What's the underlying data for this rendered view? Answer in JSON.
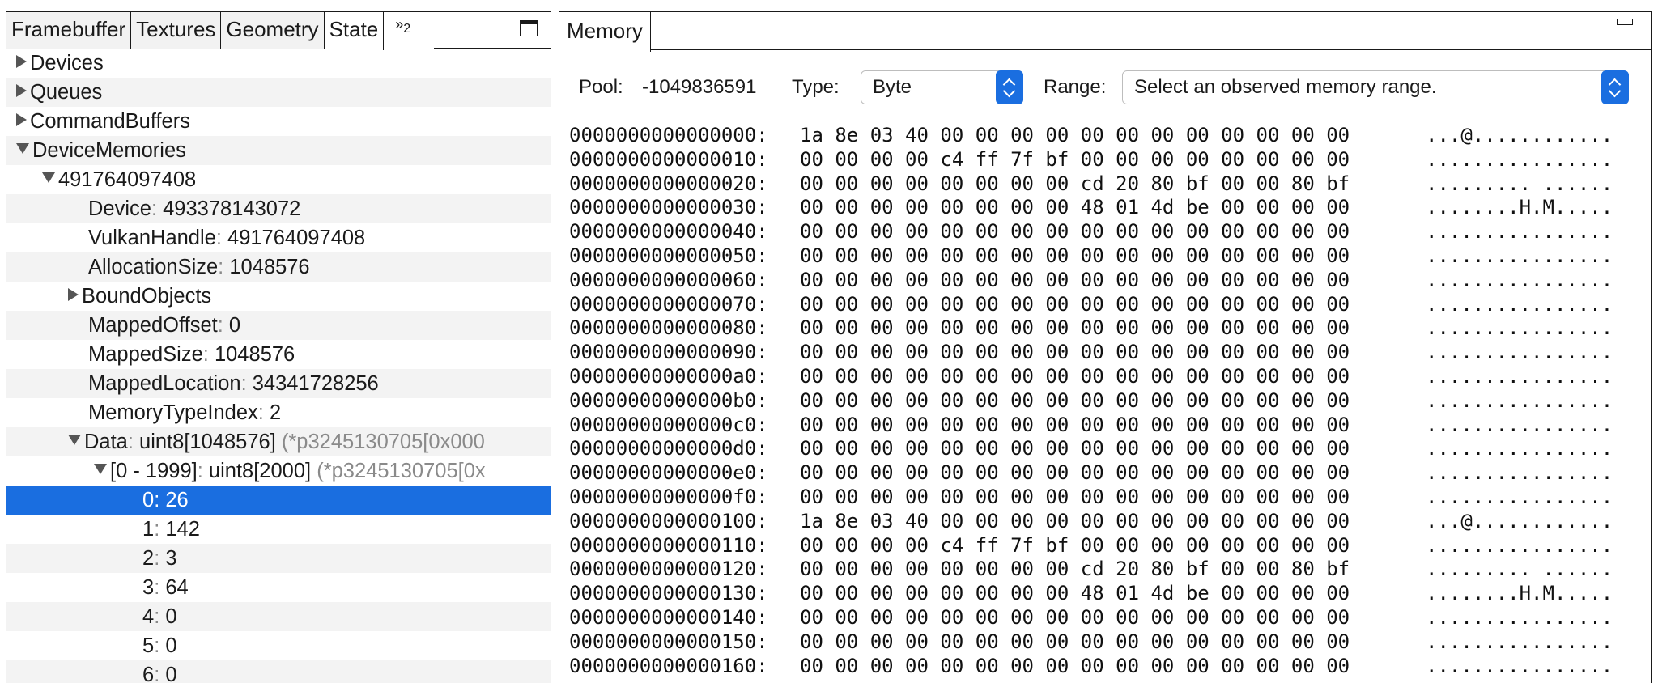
{
  "left_panel": {
    "tabs": [
      {
        "label": "Framebuffer",
        "name": "tab-framebuffer",
        "active": false
      },
      {
        "label": "Textures",
        "name": "tab-textures",
        "active": false
      },
      {
        "label": "Geometry",
        "name": "tab-geometry",
        "active": false
      },
      {
        "label": "State",
        "name": "tab-state",
        "active": true
      }
    ],
    "overflow_tab": {
      "icon": "»",
      "count": "2"
    },
    "tree": [
      {
        "indent": 0,
        "toggle": "right",
        "key": "Devices",
        "sep": "",
        "value": "",
        "extra": ""
      },
      {
        "indent": 0,
        "toggle": "right",
        "key": "Queues",
        "sep": "",
        "value": "",
        "extra": ""
      },
      {
        "indent": 0,
        "toggle": "right",
        "key": "CommandBuffers",
        "sep": "",
        "value": "",
        "extra": ""
      },
      {
        "indent": 0,
        "toggle": "down",
        "key": "DeviceMemories",
        "sep": "",
        "value": "",
        "extra": ""
      },
      {
        "indent": 1,
        "toggle": "down",
        "key": "491764097408",
        "sep": "",
        "value": "",
        "extra": ""
      },
      {
        "indent": 2,
        "toggle": "",
        "key": "Device",
        "sep": ": ",
        "value": "493378143072",
        "extra": ""
      },
      {
        "indent": 2,
        "toggle": "",
        "key": "VulkanHandle",
        "sep": ": ",
        "value": "491764097408",
        "extra": ""
      },
      {
        "indent": 2,
        "toggle": "",
        "key": "AllocationSize",
        "sep": ": ",
        "value": "1048576",
        "extra": ""
      },
      {
        "indent": 2,
        "toggle": "right",
        "key": "BoundObjects",
        "sep": "",
        "value": "",
        "extra": ""
      },
      {
        "indent": 2,
        "toggle": "",
        "key": "MappedOffset",
        "sep": ": ",
        "value": "0",
        "extra": ""
      },
      {
        "indent": 2,
        "toggle": "",
        "key": "MappedSize",
        "sep": ": ",
        "value": "1048576",
        "extra": ""
      },
      {
        "indent": 2,
        "toggle": "",
        "key": "MappedLocation",
        "sep": ": ",
        "value": "34341728256",
        "extra": ""
      },
      {
        "indent": 2,
        "toggle": "",
        "key": "MemoryTypeIndex",
        "sep": ": ",
        "value": "2",
        "extra": ""
      },
      {
        "indent": 2,
        "toggle": "down",
        "key": "Data",
        "sep": ": ",
        "value": "uint8[1048576]",
        "extra": " (*p3245130705[0x000"
      },
      {
        "indent": 3,
        "toggle": "down",
        "key": "[0 - 1999]",
        "sep": ": ",
        "value": "uint8[2000]",
        "extra": " (*p3245130705[0x"
      },
      {
        "indent": 4,
        "toggle": "",
        "key": "0",
        "sep": ": ",
        "value": "26",
        "extra": "",
        "selected": true
      },
      {
        "indent": 4,
        "toggle": "",
        "key": "1",
        "sep": ": ",
        "value": "142",
        "extra": ""
      },
      {
        "indent": 4,
        "toggle": "",
        "key": "2",
        "sep": ": ",
        "value": "3",
        "extra": ""
      },
      {
        "indent": 4,
        "toggle": "",
        "key": "3",
        "sep": ": ",
        "value": "64",
        "extra": ""
      },
      {
        "indent": 4,
        "toggle": "",
        "key": "4",
        "sep": ": ",
        "value": "0",
        "extra": ""
      },
      {
        "indent": 4,
        "toggle": "",
        "key": "5",
        "sep": ": ",
        "value": "0",
        "extra": ""
      },
      {
        "indent": 4,
        "toggle": "",
        "key": "6",
        "sep": ": ",
        "value": "0",
        "extra": ""
      }
    ]
  },
  "memory_panel": {
    "tab_label": "Memory",
    "pool_label": "Pool:",
    "pool_value": "-1049836591",
    "type_label": "Type:",
    "type_value": "Byte",
    "range_label": "Range:",
    "range_value": "Select an observed memory range.",
    "rows": [
      {
        "addr": "0000000000000000:",
        "bytes": "1a 8e 03 40 00 00 00 00 00 00 00 00 00 00 00 00",
        "ascii": "...@............"
      },
      {
        "addr": "0000000000000010:",
        "bytes": "00 00 00 00 c4 ff 7f bf 00 00 00 00 00 00 00 00",
        "ascii": "................"
      },
      {
        "addr": "0000000000000020:",
        "bytes": "00 00 00 00 00 00 00 00 cd 20 80 bf 00 00 80 bf",
        "ascii": "......... ......"
      },
      {
        "addr": "0000000000000030:",
        "bytes": "00 00 00 00 00 00 00 00 48 01 4d be 00 00 00 00",
        "ascii": "........H.M....."
      },
      {
        "addr": "0000000000000040:",
        "bytes": "00 00 00 00 00 00 00 00 00 00 00 00 00 00 00 00",
        "ascii": "................"
      },
      {
        "addr": "0000000000000050:",
        "bytes": "00 00 00 00 00 00 00 00 00 00 00 00 00 00 00 00",
        "ascii": "................"
      },
      {
        "addr": "0000000000000060:",
        "bytes": "00 00 00 00 00 00 00 00 00 00 00 00 00 00 00 00",
        "ascii": "................"
      },
      {
        "addr": "0000000000000070:",
        "bytes": "00 00 00 00 00 00 00 00 00 00 00 00 00 00 00 00",
        "ascii": "................"
      },
      {
        "addr": "0000000000000080:",
        "bytes": "00 00 00 00 00 00 00 00 00 00 00 00 00 00 00 00",
        "ascii": "................"
      },
      {
        "addr": "0000000000000090:",
        "bytes": "00 00 00 00 00 00 00 00 00 00 00 00 00 00 00 00",
        "ascii": "................"
      },
      {
        "addr": "00000000000000a0:",
        "bytes": "00 00 00 00 00 00 00 00 00 00 00 00 00 00 00 00",
        "ascii": "................"
      },
      {
        "addr": "00000000000000b0:",
        "bytes": "00 00 00 00 00 00 00 00 00 00 00 00 00 00 00 00",
        "ascii": "................"
      },
      {
        "addr": "00000000000000c0:",
        "bytes": "00 00 00 00 00 00 00 00 00 00 00 00 00 00 00 00",
        "ascii": "................"
      },
      {
        "addr": "00000000000000d0:",
        "bytes": "00 00 00 00 00 00 00 00 00 00 00 00 00 00 00 00",
        "ascii": "................"
      },
      {
        "addr": "00000000000000e0:",
        "bytes": "00 00 00 00 00 00 00 00 00 00 00 00 00 00 00 00",
        "ascii": "................"
      },
      {
        "addr": "00000000000000f0:",
        "bytes": "00 00 00 00 00 00 00 00 00 00 00 00 00 00 00 00",
        "ascii": "................"
      },
      {
        "addr": "0000000000000100:",
        "bytes": "1a 8e 03 40 00 00 00 00 00 00 00 00 00 00 00 00",
        "ascii": "...@............"
      },
      {
        "addr": "0000000000000110:",
        "bytes": "00 00 00 00 c4 ff 7f bf 00 00 00 00 00 00 00 00",
        "ascii": "................"
      },
      {
        "addr": "0000000000000120:",
        "bytes": "00 00 00 00 00 00 00 00 cd 20 80 bf 00 00 80 bf",
        "ascii": "......... ......"
      },
      {
        "addr": "0000000000000130:",
        "bytes": "00 00 00 00 00 00 00 00 48 01 4d be 00 00 00 00",
        "ascii": "........H.M....."
      },
      {
        "addr": "0000000000000140:",
        "bytes": "00 00 00 00 00 00 00 00 00 00 00 00 00 00 00 00",
        "ascii": "................"
      },
      {
        "addr": "0000000000000150:",
        "bytes": "00 00 00 00 00 00 00 00 00 00 00 00 00 00 00 00",
        "ascii": "................"
      },
      {
        "addr": "0000000000000160:",
        "bytes": "00 00 00 00 00 00 00 00 00 00 00 00 00 00 00 00",
        "ascii": "................"
      }
    ]
  },
  "colors": {
    "selection": "#1a6ee0",
    "alt_row": "#f3f3f3",
    "dim_text": "#8a8a8a"
  }
}
